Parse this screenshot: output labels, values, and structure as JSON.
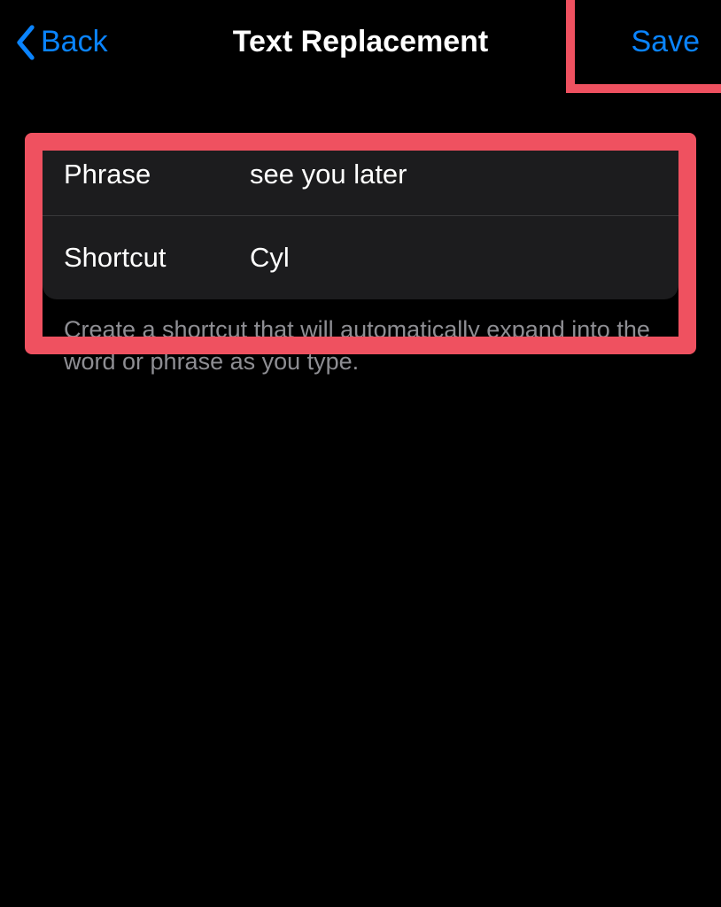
{
  "nav": {
    "back_label": "Back",
    "title": "Text Replacement",
    "save_label": "Save"
  },
  "form": {
    "phrase": {
      "label": "Phrase",
      "value": "see you later"
    },
    "shortcut": {
      "label": "Shortcut",
      "value": "Cyl"
    }
  },
  "hint": "Create a shortcut that will automatically expand into the word or phrase as you type."
}
